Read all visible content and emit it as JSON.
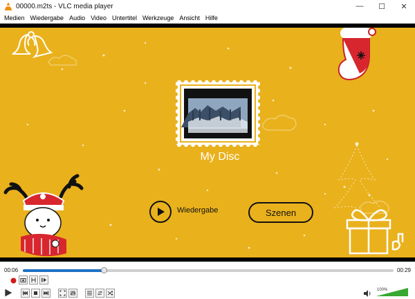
{
  "window": {
    "title": "00000.m2ts - VLC media player",
    "minimize": "—",
    "maximize": "☐",
    "close": "✕"
  },
  "menu": [
    "Medien",
    "Wiedergabe",
    "Audio",
    "Video",
    "Untertitel",
    "Werkzeuge",
    "Ansicht",
    "Hilfe"
  ],
  "disc": {
    "title": "My Disc",
    "play_label": "Wiedergabe",
    "scenes_label": "Szenen"
  },
  "player": {
    "elapsed": "00:06",
    "total": "00:29",
    "progress": 0.218,
    "volume": "100%",
    "volume_level": 1.0
  },
  "colors": {
    "background": "#e9b11c",
    "accent": "#1d72c4"
  }
}
